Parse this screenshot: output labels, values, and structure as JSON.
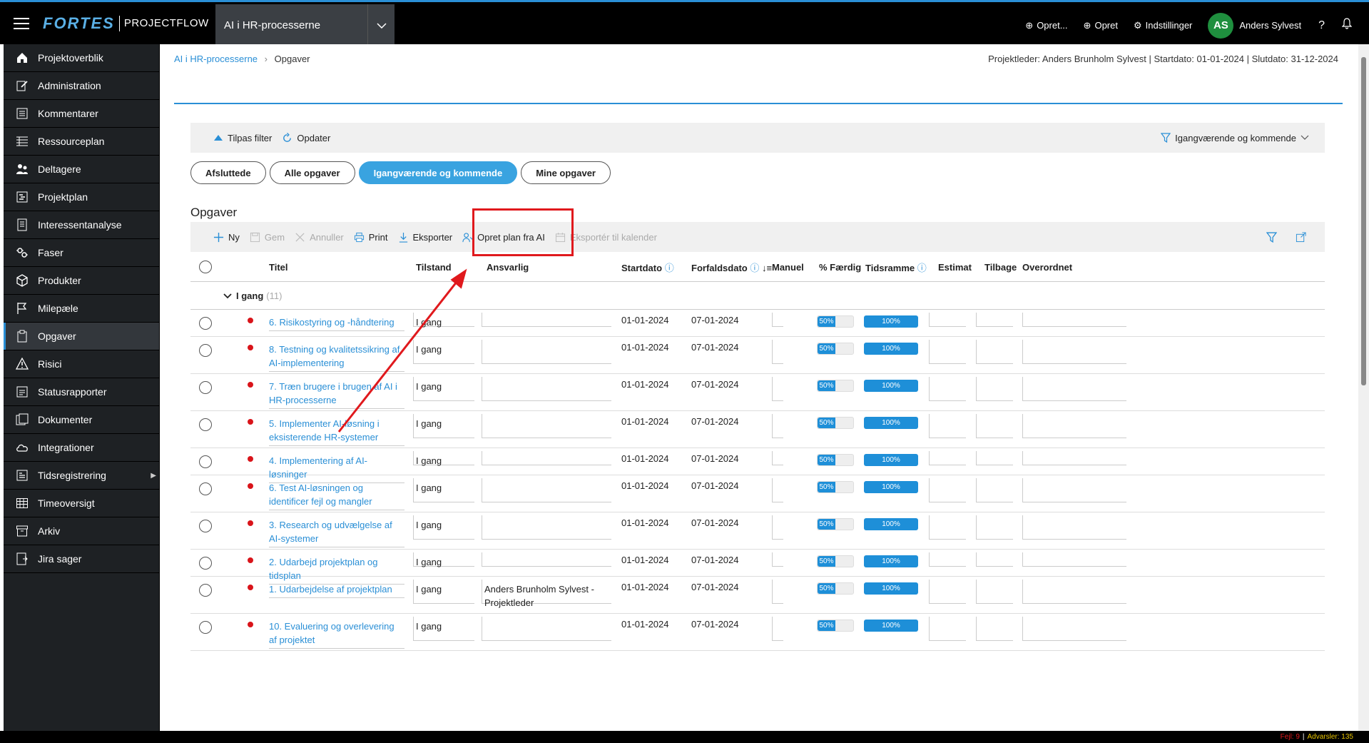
{
  "topbar": {
    "brand": "FORTES",
    "product": "PROJECTFLOW",
    "project": "AI i HR-processerne",
    "actions": [
      "Opret...",
      "Opret",
      "Indstillinger"
    ],
    "avatar_initials": "AS",
    "user_name": "Anders Sylvest"
  },
  "sidebar": {
    "items": [
      {
        "label": "Projektoverblik",
        "icon": "home-icon"
      },
      {
        "label": "Administration",
        "icon": "edit-icon"
      },
      {
        "label": "Kommentarer",
        "icon": "comments-icon"
      },
      {
        "label": "Ressourceplan",
        "icon": "resource-icon"
      },
      {
        "label": "Deltagere",
        "icon": "participants-icon"
      },
      {
        "label": "Projektplan",
        "icon": "plan-icon"
      },
      {
        "label": "Interessentanalyse",
        "icon": "stakeholder-icon"
      },
      {
        "label": "Faser",
        "icon": "phases-icon"
      },
      {
        "label": "Produkter",
        "icon": "box-icon"
      },
      {
        "label": "Milepæle",
        "icon": "flag-icon"
      },
      {
        "label": "Opgaver",
        "icon": "tasks-icon",
        "active": true
      },
      {
        "label": "Risici",
        "icon": "warning-icon"
      },
      {
        "label": "Statusrapporter",
        "icon": "report-icon"
      },
      {
        "label": "Dokumenter",
        "icon": "document-icon"
      },
      {
        "label": "Integrationer",
        "icon": "cloud-icon"
      },
      {
        "label": "Tidsregistrering",
        "icon": "time-icon",
        "has_submenu": true
      },
      {
        "label": "Timeoversigt",
        "icon": "grid-icon"
      },
      {
        "label": "Arkiv",
        "icon": "archive-icon"
      },
      {
        "label": "Jira sager",
        "icon": "jira-icon"
      }
    ]
  },
  "breadcrumb": {
    "project": "AI i HR-processerne",
    "current": "Opgaver"
  },
  "project_info": "Projektleder: Anders Brunholm Sylvest | Startdato: 01-01-2024 | Slutdato: 31-12-2024",
  "filterbar": {
    "adjust": "Tilpas filter",
    "refresh": "Opdater",
    "active_filter": "Igangværende og kommende"
  },
  "pills": [
    {
      "label": "Afsluttede",
      "active": false
    },
    {
      "label": "Alle opgaver",
      "active": false
    },
    {
      "label": "Igangværende og kommende",
      "active": true
    },
    {
      "label": "Mine opgaver",
      "active": false
    }
  ],
  "section_title": "Opgaver",
  "toolbar": {
    "new": "Ny",
    "save": "Gem",
    "cancel": "Annuller",
    "print": "Print",
    "export": "Eksporter",
    "ai_plan": "Opret plan fra AI",
    "export_calendar": "Eksportér til kalender"
  },
  "columns": {
    "title": "Titel",
    "state": "Tilstand",
    "responsible": "Ansvarlig",
    "start": "Startdato",
    "due": "Forfaldsdato",
    "manual": "Manuel",
    "pct": "% Færdig",
    "timeframe": "Tidsramme",
    "estimate": "Estimat",
    "remaining": "Tilbage",
    "parent": "Overordnet"
  },
  "group": {
    "label": "I gang",
    "count": "(11)"
  },
  "tasks": [
    {
      "title": "6. Risikostyring og -håndtering",
      "state": "I gang",
      "responsible": "",
      "start": "01-01-2024",
      "due": "07-01-2024",
      "pct_label": "50%",
      "timeframe_label": "100%",
      "lines": 1
    },
    {
      "title": "8. Testning og kvalitetssikring af AI-implementering",
      "state": "I gang",
      "responsible": "",
      "start": "01-01-2024",
      "due": "07-01-2024",
      "pct_label": "50%",
      "timeframe_label": "100%",
      "lines": 2
    },
    {
      "title": "7. Træn brugere i brugen af AI i HR-processerne",
      "state": "I gang",
      "responsible": "",
      "start": "01-01-2024",
      "due": "07-01-2024",
      "pct_label": "50%",
      "timeframe_label": "100%",
      "lines": 2
    },
    {
      "title": "5. Implementer AI-løsning i eksisterende HR-systemer",
      "state": "I gang",
      "responsible": "",
      "start": "01-01-2024",
      "due": "07-01-2024",
      "pct_label": "50%",
      "timeframe_label": "100%",
      "lines": 2
    },
    {
      "title": "4. Implementering af AI-løsninger",
      "state": "I gang",
      "responsible": "",
      "start": "01-01-2024",
      "due": "07-01-2024",
      "pct_label": "50%",
      "timeframe_label": "100%",
      "lines": 1
    },
    {
      "title": "6. Test AI-løsningen og identificer fejl og mangler",
      "state": "I gang",
      "responsible": "",
      "start": "01-01-2024",
      "due": "07-01-2024",
      "pct_label": "50%",
      "timeframe_label": "100%",
      "lines": 2
    },
    {
      "title": "3. Research og udvælgelse af AI-systemer",
      "state": "I gang",
      "responsible": "",
      "start": "01-01-2024",
      "due": "07-01-2024",
      "pct_label": "50%",
      "timeframe_label": "100%",
      "lines": 2
    },
    {
      "title": "2. Udarbejd projektplan og tidsplan",
      "state": "I gang",
      "responsible": "",
      "start": "01-01-2024",
      "due": "07-01-2024",
      "pct_label": "50%",
      "timeframe_label": "100%",
      "lines": 1
    },
    {
      "title": "1. Udarbejdelse af projektplan",
      "state": "I gang",
      "responsible": "Anders Brunholm Sylvest - Projektleder",
      "start": "01-01-2024",
      "due": "07-01-2024",
      "pct_label": "50%",
      "timeframe_label": "100%",
      "lines": 2
    },
    {
      "title": "10. Evaluering og overlevering af projektet",
      "state": "I gang",
      "responsible": "",
      "start": "01-01-2024",
      "due": "07-01-2024",
      "pct_label": "50%",
      "timeframe_label": "100%",
      "lines": 2
    }
  ],
  "statusbar": {
    "errors": "Fejl: 9",
    "warnings": "Advarsler: 135"
  },
  "colors": {
    "accent": "#2a8fd6",
    "active_pill": "#39a3e0",
    "annotation": "#e0191d",
    "status_dot": "#d9141a",
    "avatar": "#1f8f3e"
  }
}
